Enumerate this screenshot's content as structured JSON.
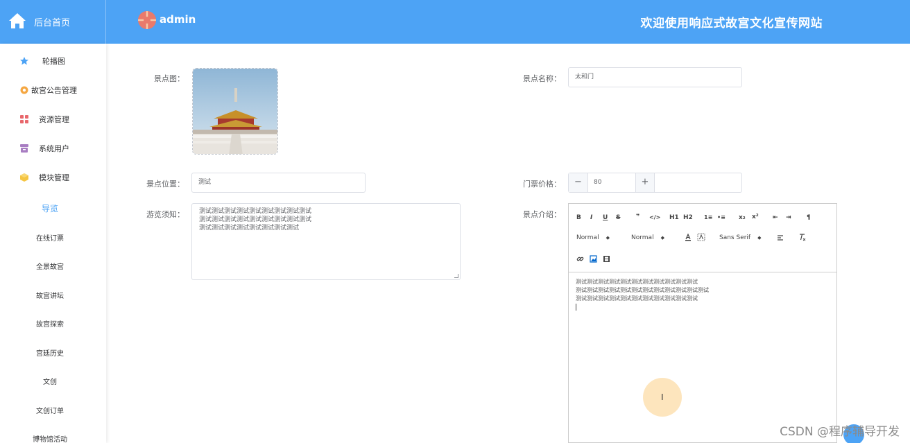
{
  "header": {
    "home_label": "后台首页",
    "username": "admin",
    "site_title": "欢迎使用响应式故宫文化宣传网站",
    "bg_color": "#4da3f5"
  },
  "sidebar": {
    "items": [
      {
        "label": "轮播图",
        "icon": "star-icon",
        "color": "#4da3f5"
      },
      {
        "label": "故宫公告管理",
        "icon": "gear-icon",
        "color": "#f5a742"
      },
      {
        "label": "资源管理",
        "icon": "grid-icon",
        "color": "#e8676c"
      },
      {
        "label": "系统用户",
        "icon": "user-box-icon",
        "color": "#a87dc2"
      },
      {
        "label": "模块管理",
        "icon": "cube-icon",
        "color": "#f5c542"
      }
    ],
    "submenu": {
      "active": "导览",
      "items": [
        "在线订票",
        "全景故宫",
        "故宫讲坛",
        "故宫探索",
        "宫廷历史",
        "文创",
        "文创订单",
        "博物馆活动"
      ]
    }
  },
  "form": {
    "image_label": "景点图：",
    "name_label": "景点名称：",
    "name_value": "太和门",
    "location_label": "景点位置：",
    "location_value": "测试",
    "price_label": "门票价格：",
    "price_value": "80",
    "price_minus": "−",
    "price_plus": "+",
    "notice_label": "游览须知：",
    "notice_lines": [
      "测试测试测试测试测试测试测试测试测试",
      "测试测试测试测试测试测试测试测试测试",
      "测试测试测试测试测试测试测试测试"
    ],
    "intro_label": "景点介绍：",
    "intro_lines": [
      "测试测试测试测试测试测试测试测试测试测试测试",
      "测试测试测试测试测试测试测试测试测试测试测试测试",
      "测试测试测试测试测试测试测试测试测试测试测试"
    ]
  },
  "editor": {
    "toolbar_row1": [
      "B",
      "I",
      "U",
      "S",
      "❞",
      "</>",
      "H1",
      "H2",
      "1≡",
      "•≡",
      "x₂",
      "x²",
      "⇤",
      "⇥",
      "¶"
    ],
    "header_select": "Normal",
    "size_select": "Normal",
    "font_select": "Sans Serif",
    "toolbar_row3_icons": [
      "link-icon",
      "image-icon",
      "video-icon"
    ]
  },
  "watermark": "CSDN @程序辅导开发"
}
